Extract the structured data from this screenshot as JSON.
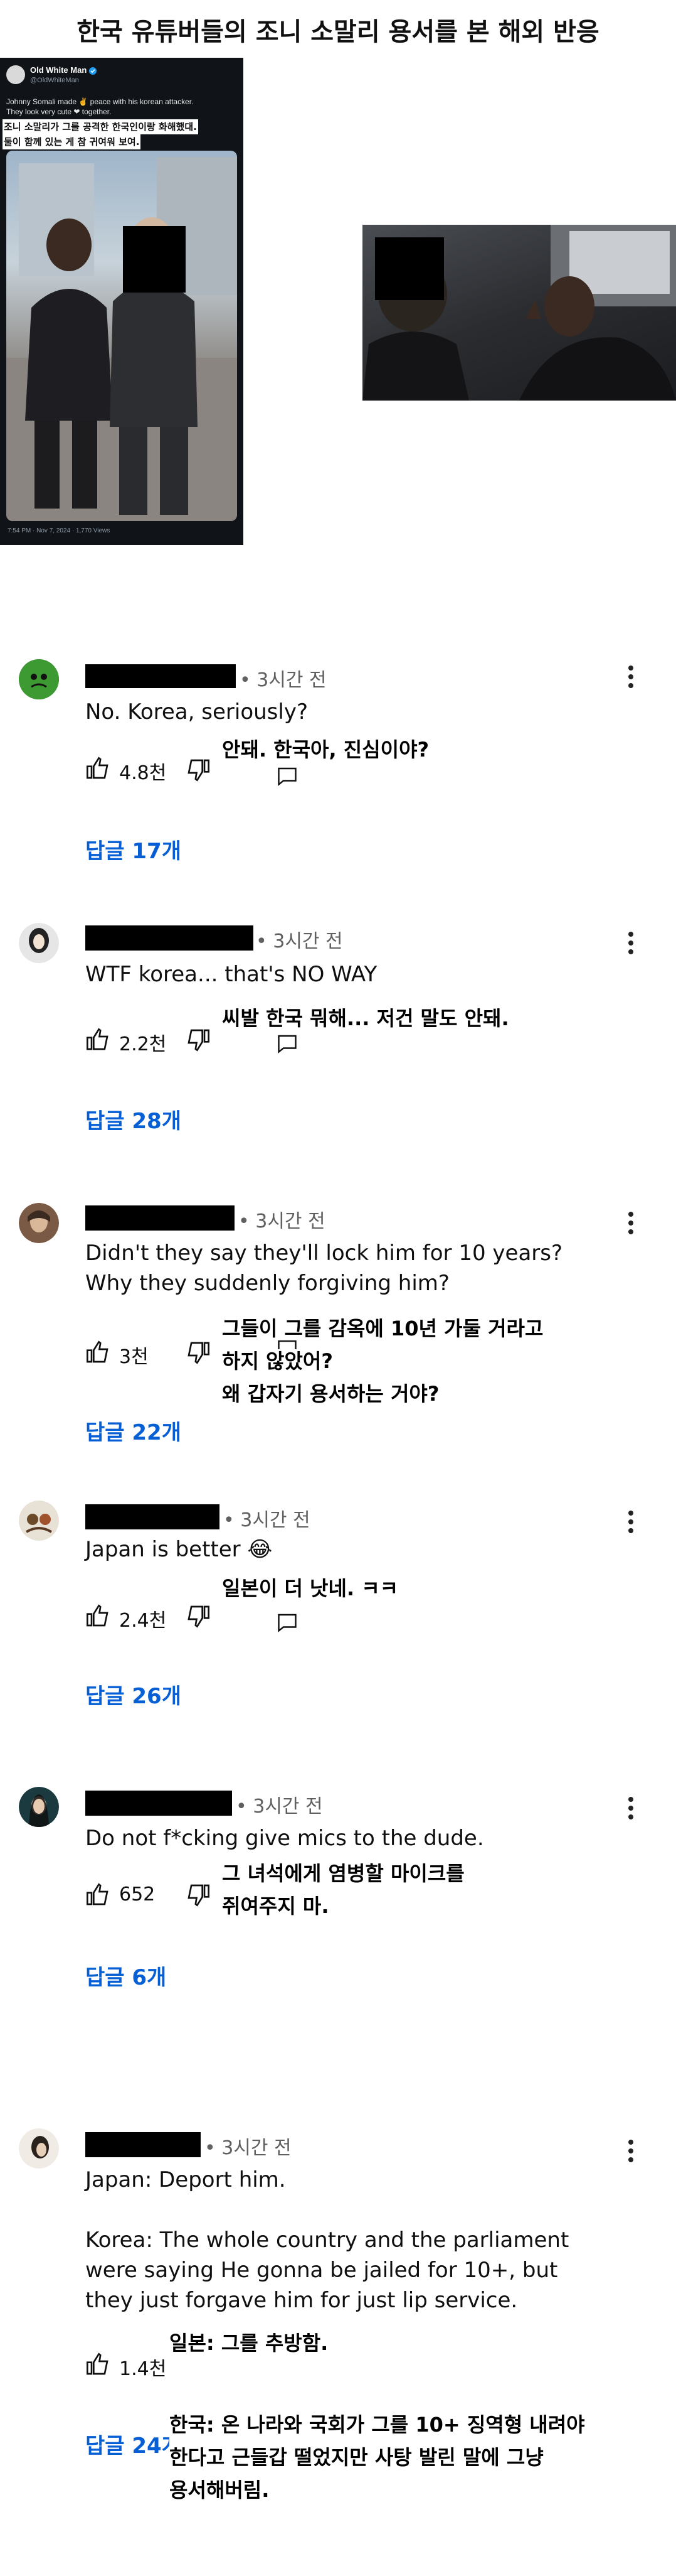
{
  "title": "한국 유튜버들의 조니 소말리 용서를 본 해외 반응",
  "tweet": {
    "name": "Old White Man",
    "handle": "@OldWhiteMan",
    "text_line1": "Johnny Somali made ✌ peace with his korean attacker.",
    "text_line2": "They look very cute ❤ together.",
    "korean_line1": "조니 소말리가 그를 공격한 한국인이랑 화해했대.",
    "korean_line2": "둘이 함께 있는 게 참 귀여워 보여.",
    "footer": "7:54 PM · Nov 7, 2024 · 1,770 Views"
  },
  "comments": [
    {
      "time": "• 3시간 전",
      "text": "No. Korea, seriously?",
      "likes": "4.8천",
      "replies": "답글 17개",
      "translation": "안돼. 한국아, 진심이야?"
    },
    {
      "time": "• 3시간 전",
      "text": "WTF korea... that's NO WAY",
      "likes": "2.2천",
      "replies": "답글 28개",
      "translation": "씨발 한국 뭐해... 저건 말도 안돼."
    },
    {
      "time": "• 3시간 전",
      "text": "Didn't they say they'll lock him for 10 years?\nWhy they suddenly forgiving him?",
      "likes": "3천",
      "replies": "답글 22개",
      "translation": "그들이 그를 감옥에 10년 가둘 거라고\n하지 않았어?\n왜 갑자기 용서하는 거야?"
    },
    {
      "time": "• 3시간 전",
      "text": "Japan is better 😂",
      "likes": "2.4천",
      "replies": "답글 26개",
      "translation": "일본이 더 낫네. ㅋㅋ"
    },
    {
      "time": "• 3시간 전",
      "text": "Do not f*cking give mics to the dude.",
      "likes": "652",
      "replies": "답글 6개",
      "translation": "그 녀석에게 염병할 마이크를\n쥐여주지 마."
    },
    {
      "time": "• 3시간 전",
      "text": "Japan: Deport him.\n\nKorea: The whole country and the parliament\nwere saying He gonna be jailed for 10+, but\nthey just forgave him for just lip service.",
      "likes": "1.4천",
      "replies": "답글 24개",
      "translation": "일본: 그를 추방함.",
      "translation2": "한국: 온 나라와 국회가 그를 10+ 징역형 내려야\n한다고 근들갑 떨었지만 사탕 발린 말에 그냥\n용서해버림."
    }
  ],
  "colors": {
    "reply_link": "#065fd4",
    "meta": "#606060",
    "censor": "#000000"
  },
  "icons": [
    "like-icon",
    "dislike-icon",
    "reply-icon",
    "more-vert-icon",
    "verified-icon"
  ]
}
